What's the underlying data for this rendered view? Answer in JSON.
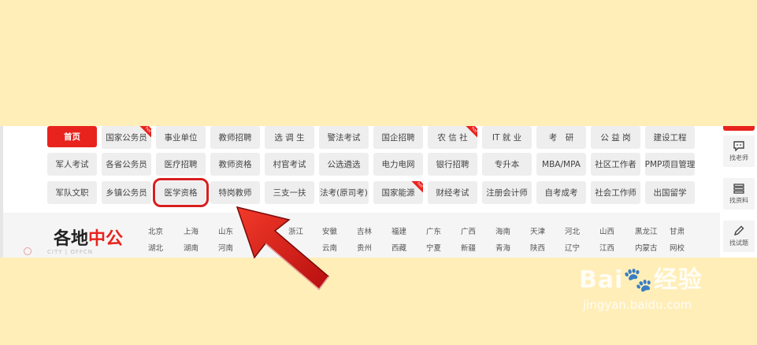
{
  "nav": {
    "rows": [
      [
        {
          "label": "首页",
          "home": true
        },
        {
          "label": "国家公务员",
          "hot": true
        },
        {
          "label": "事业单位"
        },
        {
          "label": "教师招聘"
        },
        {
          "label": "选 调 生"
        },
        {
          "label": "警法考试"
        },
        {
          "label": "国企招聘"
        },
        {
          "label": "农 信 社",
          "hot": true
        },
        {
          "label": "IT 就 业"
        },
        {
          "label": "考　研"
        },
        {
          "label": "公 益 岗"
        },
        {
          "label": "建设工程"
        }
      ],
      [
        {
          "label": "军人考试"
        },
        {
          "label": "各省公务员"
        },
        {
          "label": "医疗招聘"
        },
        {
          "label": "教师资格"
        },
        {
          "label": "村官考试"
        },
        {
          "label": "公选遴选"
        },
        {
          "label": "电力电网"
        },
        {
          "label": "银行招聘"
        },
        {
          "label": "专升本"
        },
        {
          "label": "MBA/MPA"
        },
        {
          "label": "社区工作者"
        },
        {
          "label": "PMP项目管理"
        }
      ],
      [
        {
          "label": "军队文职"
        },
        {
          "label": "乡镇公务员"
        },
        {
          "label": "医学资格",
          "circled": true
        },
        {
          "label": "特岗教师"
        },
        {
          "label": "三支一扶"
        },
        {
          "label": "法考(原司考)"
        },
        {
          "label": "国家能源",
          "hot": true
        },
        {
          "label": "财经考试"
        },
        {
          "label": "注册会计师"
        },
        {
          "label": "自考成考"
        },
        {
          "label": "社会工作师"
        },
        {
          "label": "出国留学"
        }
      ]
    ],
    "hot_badge": "hot"
  },
  "side_tools": [
    {
      "label": "找老师",
      "icon": "chat-icon"
    },
    {
      "label": "找资料",
      "icon": "stack-icon"
    },
    {
      "label": "找试题",
      "icon": "pencil-icon"
    }
  ],
  "regions_block": {
    "title_plain": "各地",
    "title_red": "中公",
    "subtitle": "CITY | OFFCN",
    "row1": [
      "北京",
      "上海",
      "山东",
      "",
      "浙江",
      "安徽",
      "吉林",
      "福建",
      "广东",
      "广西",
      "海南",
      "天津",
      "河北",
      "山西",
      "黑龙江",
      "甘肃"
    ],
    "row2": [
      "湖北",
      "湖南",
      "河南",
      "",
      "",
      "云南",
      "贵州",
      "西藏",
      "宁夏",
      "新疆",
      "青海",
      "陕西",
      "辽宁",
      "江西",
      "内蒙古",
      "网校"
    ]
  },
  "watermark": {
    "brand_prefix": "Bai",
    "brand_suffix": "经验",
    "url": "jingyan.baidu.com"
  },
  "colors": {
    "accent_red": "#e8231d",
    "background": "#ffeeb8"
  }
}
